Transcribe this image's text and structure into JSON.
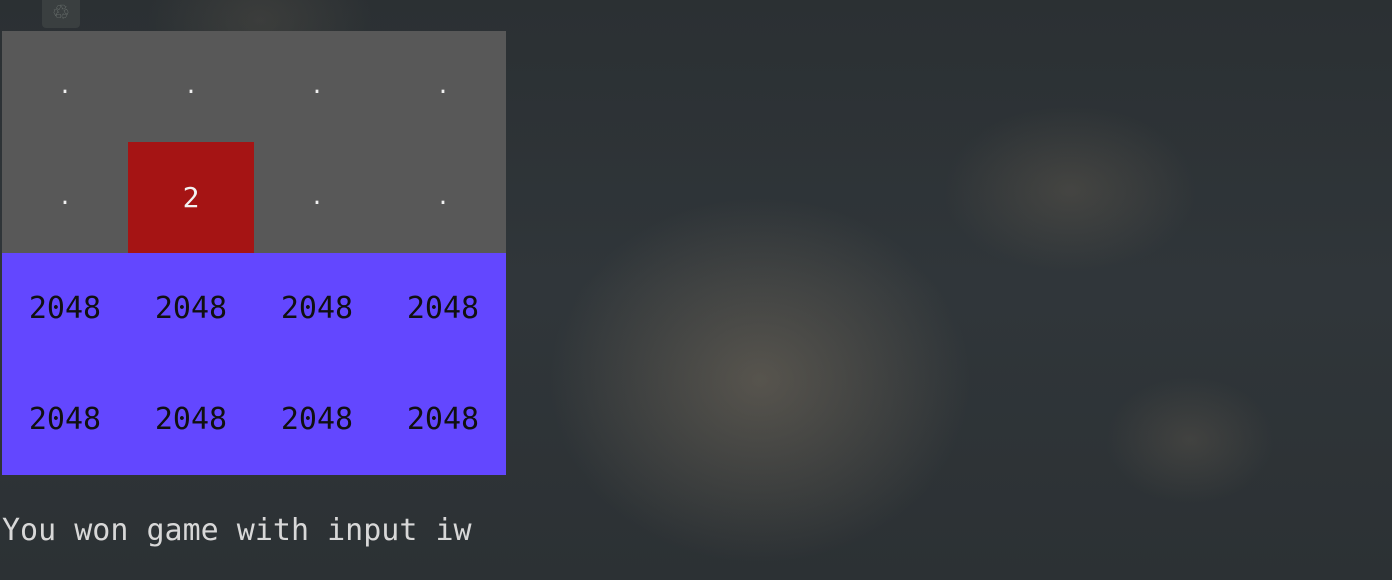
{
  "tray": {
    "icon": "recycle-icon",
    "glyph": "♲"
  },
  "board": {
    "rows": [
      [
        ".",
        ".",
        ".",
        "."
      ],
      [
        ".",
        "2",
        ".",
        "."
      ],
      [
        "2048",
        "2048",
        "2048",
        "2048"
      ],
      [
        "2048",
        "2048",
        "2048",
        "2048"
      ]
    ]
  },
  "tile_colors": {
    "empty": "#585858",
    "2": "#a51414",
    "2048": "#6347ff"
  },
  "status": {
    "message": "You won game with input iw"
  }
}
